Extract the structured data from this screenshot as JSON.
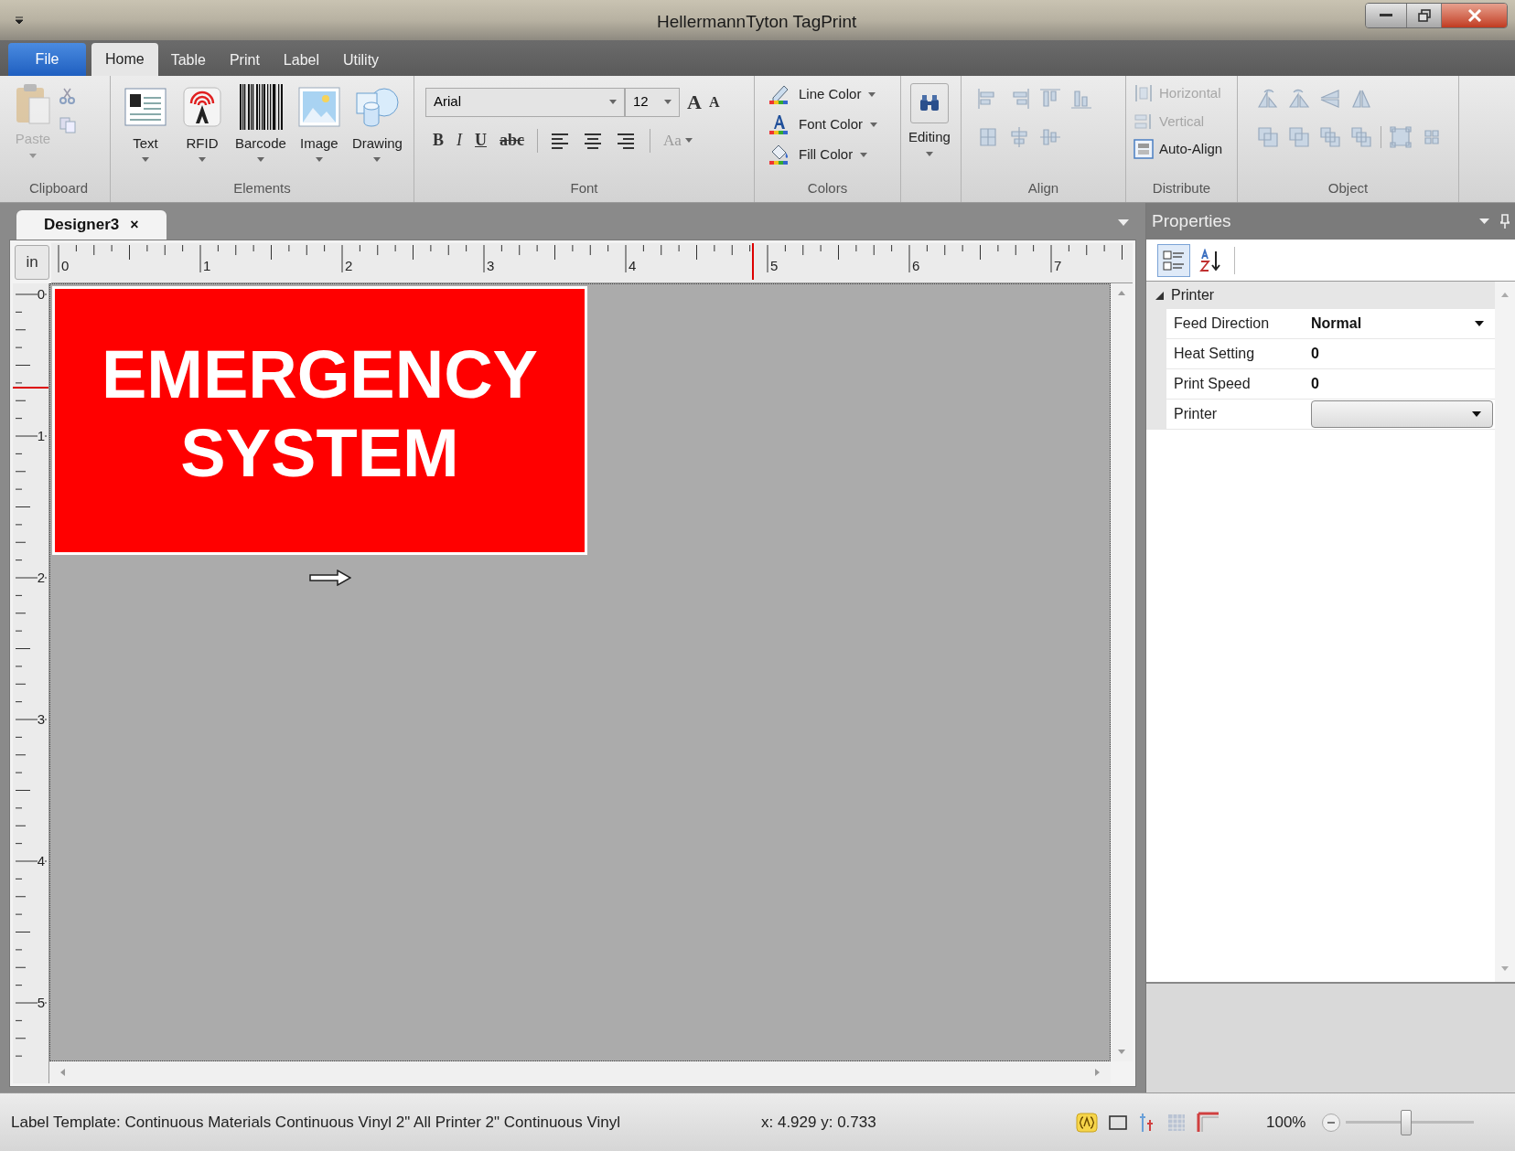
{
  "window": {
    "title": "HellermannTyton TagPrint"
  },
  "ribbon_tabs": [
    {
      "label": "File",
      "kind": "file"
    },
    {
      "label": "Home",
      "kind": "tab",
      "selected": true
    },
    {
      "label": "Table",
      "kind": "tab",
      "selected": false
    },
    {
      "label": "Print",
      "kind": "tab",
      "selected": false
    },
    {
      "label": "Label",
      "kind": "tab",
      "selected": false
    },
    {
      "label": "Utility",
      "kind": "tab",
      "selected": false
    }
  ],
  "ribbon": {
    "clipboard": {
      "label": "Clipboard",
      "paste": {
        "label": "Paste",
        "disabled": true
      }
    },
    "elements": {
      "label": "Elements",
      "buttons": [
        {
          "label": "Text",
          "kind": "text"
        },
        {
          "label": "RFID",
          "kind": "rfid"
        },
        {
          "label": "Barcode",
          "kind": "barcode"
        },
        {
          "label": "Image",
          "kind": "image"
        },
        {
          "label": "Drawing",
          "kind": "drawing"
        }
      ]
    },
    "font": {
      "label": "Font",
      "font_name": "Arial",
      "font_size": "12",
      "grow": "A",
      "shrink": "A",
      "styles": [
        "B",
        "I",
        "U",
        "abc"
      ],
      "change_case": "Aa"
    },
    "colors": {
      "label": "Colors",
      "items": [
        {
          "label": "Line Color",
          "kind": "line"
        },
        {
          "label": "Font Color",
          "kind": "font"
        },
        {
          "label": "Fill Color",
          "kind": "fill"
        }
      ]
    },
    "editing": {
      "label": "Editing"
    },
    "align": {
      "label": "Align"
    },
    "distribute": {
      "label": "Distribute",
      "items": [
        {
          "label": "Horizontal",
          "kind": "horizontal",
          "disabled": true
        },
        {
          "label": "Vertical",
          "kind": "vertical",
          "disabled": true
        },
        {
          "label": "Auto-Align",
          "kind": "auto",
          "disabled": false
        }
      ]
    },
    "object": {
      "label": "Object"
    }
  },
  "document_tabs": [
    {
      "label": "Designer3",
      "close": "×",
      "selected": true
    }
  ],
  "ruler": {
    "unit": "in",
    "horizontal_labels": [
      "0",
      "1",
      "2",
      "3",
      "4",
      "5",
      "6",
      "7"
    ],
    "vertical_labels": [
      "0",
      "1",
      "2",
      "3",
      "4",
      "5"
    ]
  },
  "label": {
    "text": "EMERGENCY SYSTEM"
  },
  "properties": {
    "title": "Properties",
    "view_buttons": [
      {
        "kind": "categorized",
        "selected": true
      },
      {
        "kind": "alphabetical",
        "selected": false
      }
    ],
    "category": {
      "label": "Printer",
      "expanded": true,
      "rows": [
        {
          "name": "Feed Direction",
          "value": "Normal",
          "kind": "dropdown"
        },
        {
          "name": "Heat Setting",
          "value": "0",
          "kind": "text"
        },
        {
          "name": "Print Speed",
          "value": "0",
          "kind": "text"
        },
        {
          "name": "Printer",
          "kind": "combo"
        }
      ]
    }
  },
  "status_bar": {
    "template": "Label Template: Continuous Materials Continuous Vinyl 2\" All Printer 2\" Continuous Vinyl",
    "coordinates": "x: 4.929 y: 0.733",
    "zoom": "100%",
    "zoom_slider": {
      "level": 0.47
    }
  }
}
